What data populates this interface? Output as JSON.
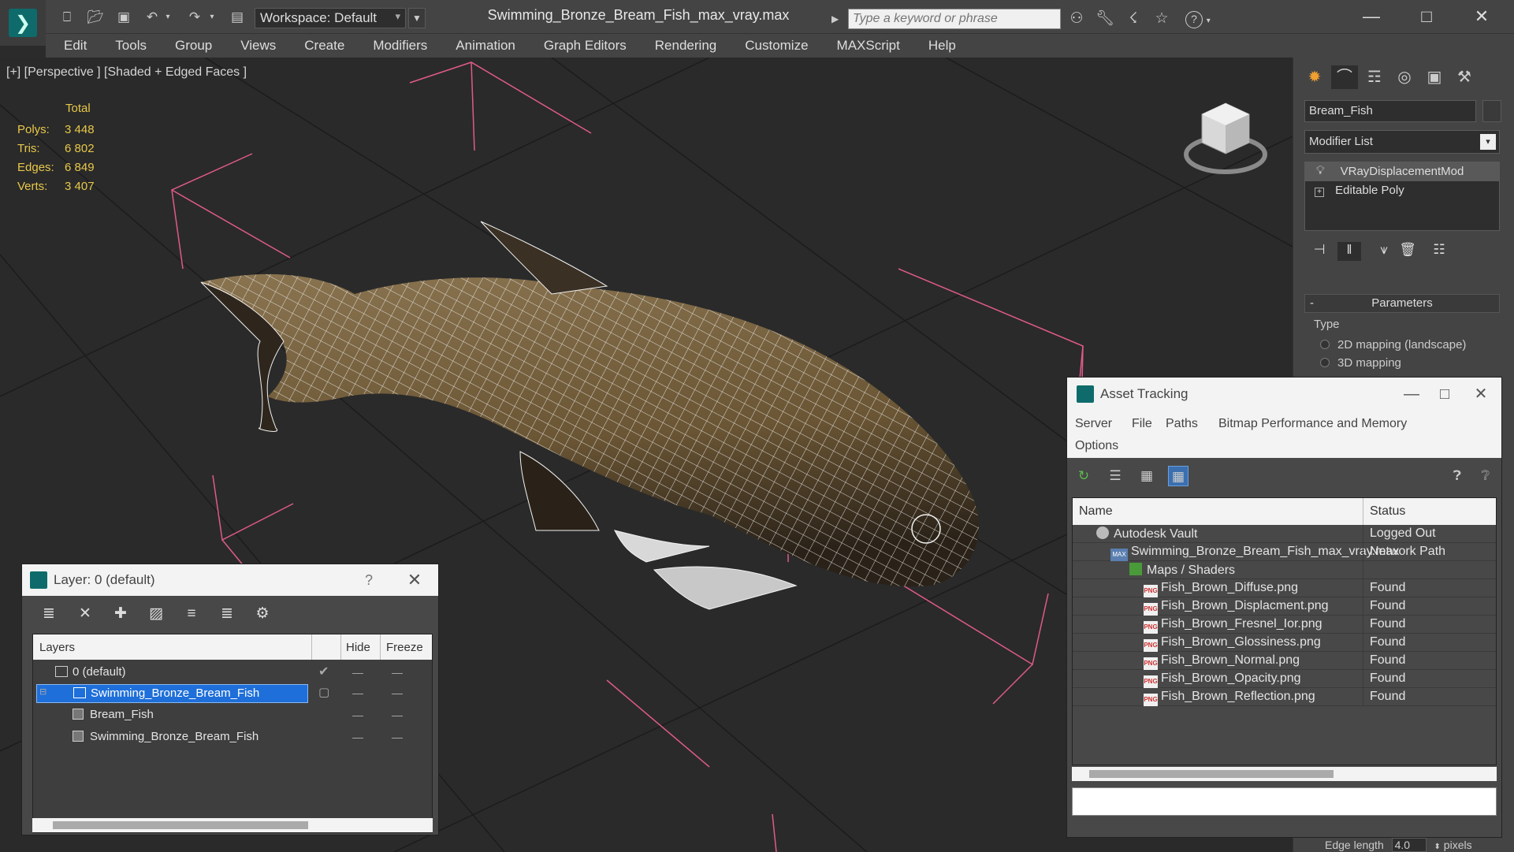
{
  "titlebar": {
    "workspace_label": "Workspace: Default",
    "document_title": "Swimming_Bronze_Bream_Fish_max_vray.max",
    "search_placeholder": "Type a keyword or phrase",
    "help_label": "?"
  },
  "menubar": [
    "Edit",
    "Tools",
    "Group",
    "Views",
    "Create",
    "Modifiers",
    "Animation",
    "Graph Editors",
    "Rendering",
    "Customize",
    "MAXScript",
    "Help"
  ],
  "viewport": {
    "label": "[+] [Perspective ] [Shaded + Edged Faces ]",
    "stats": {
      "total_label": "Total",
      "rows": [
        {
          "label": "Polys:",
          "value": "3 448"
        },
        {
          "label": "Tris:",
          "value": "6 802"
        },
        {
          "label": "Edges:",
          "value": "6 849"
        },
        {
          "label": "Verts:",
          "value": "3 407"
        }
      ]
    }
  },
  "command_panel": {
    "object_name": "Bream_Fish",
    "modifier_list": "Modifier List",
    "stack": [
      "VRayDisplacementMod",
      "Editable Poly"
    ],
    "parameters_label": "Parameters",
    "type_label": "Type",
    "radio_options": [
      "2D mapping (landscape)",
      "3D mapping"
    ],
    "edge_length_label": "Edge length",
    "edge_length_value": "4.0",
    "edge_length_unit": "pixels"
  },
  "asset_tracking": {
    "title": "Asset Tracking",
    "menu": [
      "Server",
      "File",
      "Paths",
      "Bitmap Performance and Memory",
      "Options"
    ],
    "columns": {
      "name": "Name",
      "status": "Status"
    },
    "rows": [
      {
        "name": "Autodesk Vault",
        "status": "Logged Out",
        "icon": "vault-icon",
        "indent": 1
      },
      {
        "name": "Swimming_Bronze_Bream_Fish_max_vray.max",
        "status": "Network Path",
        "icon": "max-file-icon",
        "indent": 2
      },
      {
        "name": "Maps / Shaders",
        "status": "",
        "icon": "maps-icon",
        "indent": 3
      },
      {
        "name": "Fish_Brown_Diffuse.png",
        "status": "Found",
        "icon": "png-icon",
        "indent": 4
      },
      {
        "name": "Fish_Brown_Displacment.png",
        "status": "Found",
        "icon": "png-icon",
        "indent": 4
      },
      {
        "name": "Fish_Brown_Fresnel_Ior.png",
        "status": "Found",
        "icon": "png-icon",
        "indent": 4
      },
      {
        "name": "Fish_Brown_Glossiness.png",
        "status": "Found",
        "icon": "png-icon",
        "indent": 4
      },
      {
        "name": "Fish_Brown_Normal.png",
        "status": "Found",
        "icon": "png-icon",
        "indent": 4
      },
      {
        "name": "Fish_Brown_Opacity.png",
        "status": "Found",
        "icon": "png-icon",
        "indent": 4
      },
      {
        "name": "Fish_Brown_Reflection.png",
        "status": "Found",
        "icon": "png-icon",
        "indent": 4
      }
    ],
    "png_badge": "PNG",
    "max_badge": "MAX"
  },
  "layer_window": {
    "title": "Layer: 0 (default)",
    "help": "?",
    "columns": {
      "layers": "Layers",
      "hide": "Hide",
      "freeze": "Freeze"
    },
    "rows": [
      {
        "name": "0 (default)",
        "kind": "layer",
        "current": true
      },
      {
        "name": "Swimming_Bronze_Bream_Fish",
        "kind": "layer",
        "selected": true
      },
      {
        "name": "Bream_Fish",
        "kind": "object"
      },
      {
        "name": "Swimming_Bronze_Bream_Fish",
        "kind": "object"
      }
    ]
  },
  "colors": {
    "accent": "#1e6fd9",
    "stats_text": "#e8c84a",
    "selection_box": "#e05a8a",
    "wire": "#ffffff",
    "fish_body": "#7a6440"
  }
}
